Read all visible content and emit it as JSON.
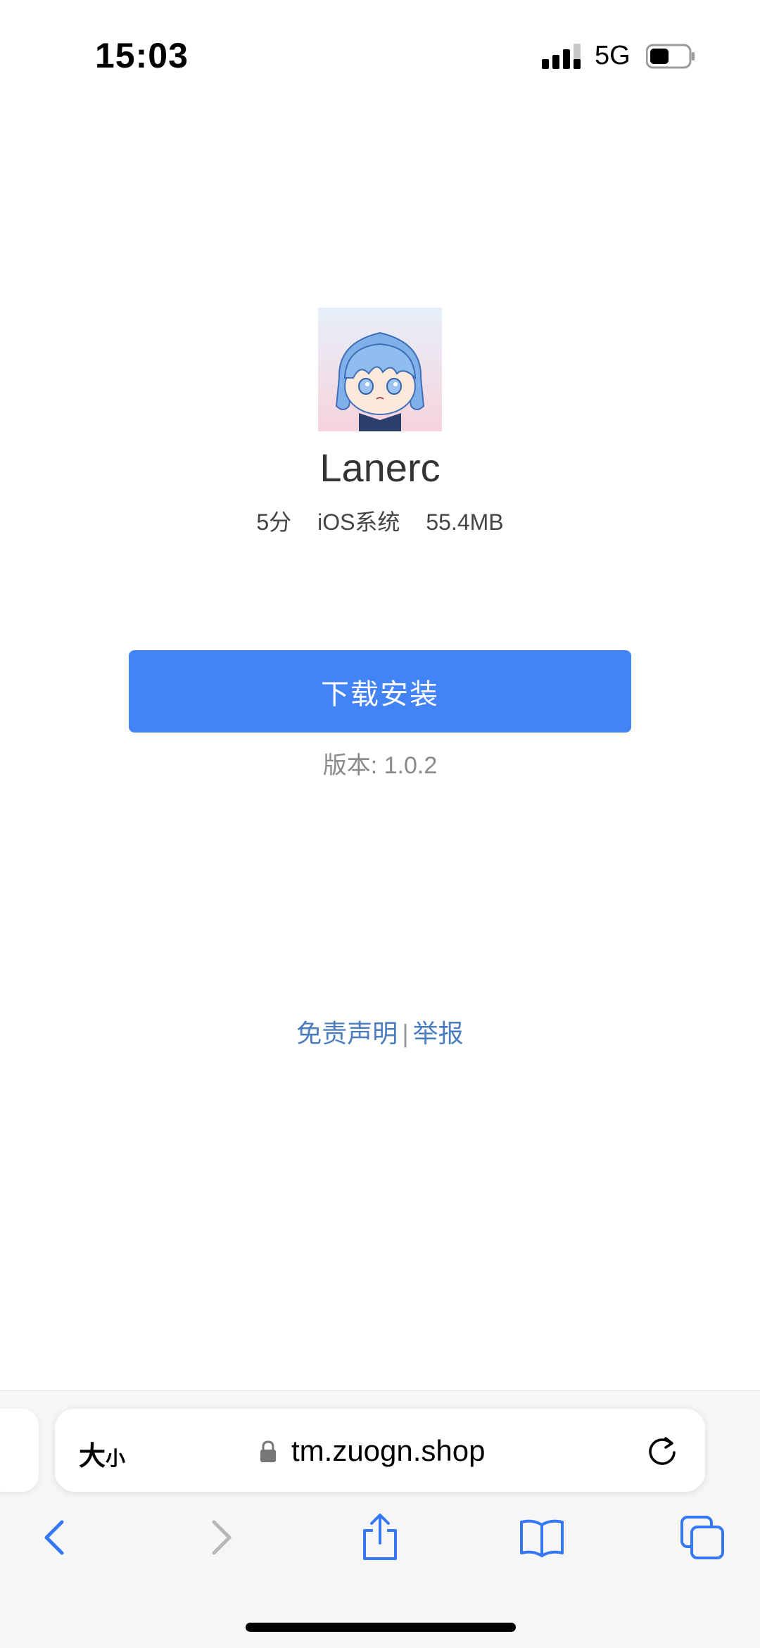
{
  "status_bar": {
    "time": "15:03",
    "network": "5G"
  },
  "app": {
    "name": "Lanerc",
    "rating": "5分",
    "platform": "iOS系统",
    "size": "55.4MB",
    "download_label": "下载安装",
    "version": "版本: 1.0.2"
  },
  "footer": {
    "disclaimer": "免责声明",
    "separator": "|",
    "report": "举报"
  },
  "browser": {
    "text_size_big": "大",
    "text_size_small": "小",
    "url": "tm.zuogn.shop"
  },
  "colors": {
    "accent": "#4283F5",
    "link": "#4a7cc0",
    "toolbar_icon": "#3478F6"
  },
  "icons": [
    "signal-icon",
    "battery-icon",
    "lock-icon",
    "reload-icon",
    "back-icon",
    "forward-icon",
    "share-icon",
    "bookmarks-icon",
    "tabs-icon"
  ]
}
